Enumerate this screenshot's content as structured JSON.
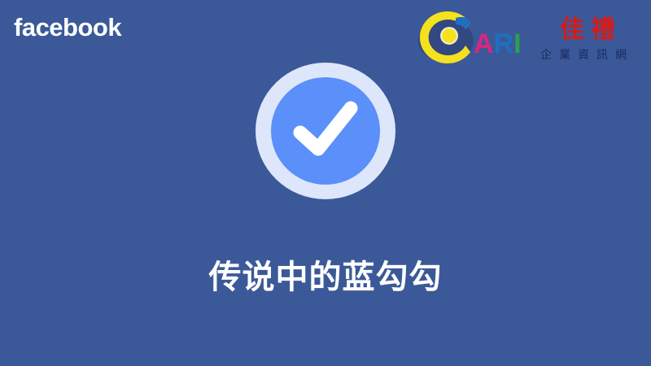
{
  "brand": {
    "name": "facebook"
  },
  "partner_logo": {
    "wordmark": "ARI",
    "chinese_title": "佳禮",
    "chinese_subtitle": "企業資訊網",
    "colors": {
      "yellow": "#f5e11e",
      "blue": "#1f6fc0",
      "magenta": "#d8267f",
      "green": "#2aa14a",
      "red": "#d71a1a"
    }
  },
  "badge": {
    "icon": "verified-checkmark-icon",
    "colors": {
      "ring": "#dde6fb",
      "fill": "#5b8ff9",
      "check": "#ffffff"
    }
  },
  "caption": {
    "text": "传说中的蓝勾勾"
  },
  "colors": {
    "background": "#3b5998",
    "text": "#ffffff"
  }
}
